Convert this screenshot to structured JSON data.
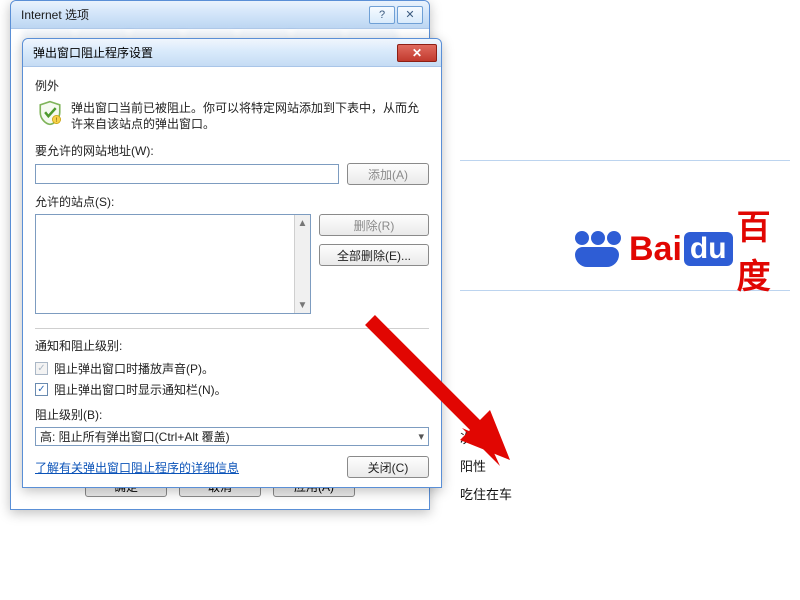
{
  "back_window": {
    "title": "Internet 选项",
    "help_btn": "?",
    "close_btn": "✕",
    "buttons": {
      "ok": "确定",
      "cancel": "取消",
      "apply": "应用(A)"
    }
  },
  "dialog": {
    "title": "弹出窗口阻止程序设置",
    "close_btn": "✕",
    "exceptions_header": "例外",
    "explain_text": "弹出窗口当前已被阻止。你可以将特定网站添加到下表中，从而允许来自该站点的弹出窗口。",
    "address_label": "要允许的网站地址(W):",
    "address_value": "",
    "add_btn": "添加(A)",
    "allowed_label": "允许的站点(S):",
    "remove_btn": "删除(R)",
    "remove_all_btn": "全部删除(E)...",
    "notify_header": "通知和阻止级别:",
    "cb_sound": "阻止弹出窗口时播放声音(P)。",
    "cb_bar": "阻止弹出窗口时显示通知栏(N)。",
    "cb_sound_checked": true,
    "cb_bar_checked": true,
    "level_label": "阻止级别(B):",
    "level_value": "高: 阻止所有弹出窗口(Ctrl+Alt 覆盖)",
    "info_link": "了解有关弹出窗口阻止程序的详细信息",
    "close_dlg_btn": "关闭(C)"
  },
  "baidu": {
    "bai": "Bai",
    "du": "du",
    "cn": "百度"
  },
  "stray": {
    "s1": "次",
    "s2": "阳性",
    "s3": "吃住在车"
  }
}
